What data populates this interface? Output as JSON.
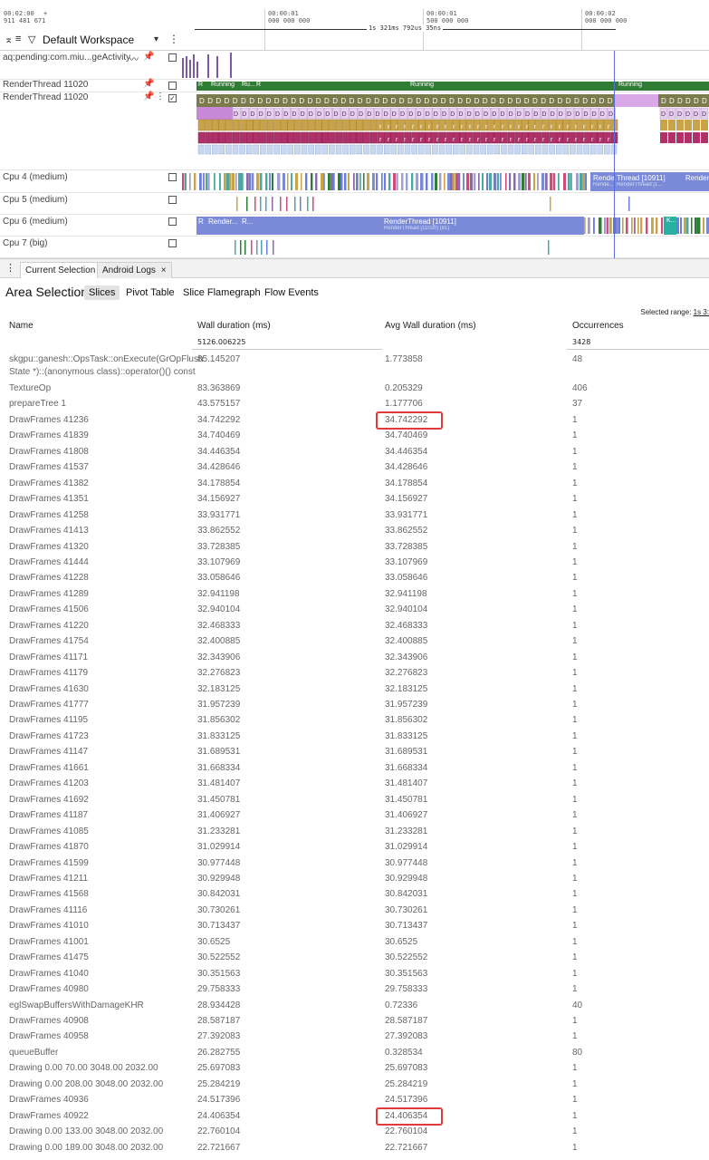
{
  "ruler": {
    "origin_time": "00:02:00",
    "origin_ns": "911 481 671",
    "plus": "+",
    "ticks": [
      {
        "t1": "00:00:01",
        "t2": "000 000 000"
      },
      {
        "t1": "00:00:01",
        "t2": "500 000 000"
      },
      {
        "t1": "00:00:02",
        "t2": "000 000 000"
      }
    ],
    "span_label": "1s 321ms 792us 35ns"
  },
  "workspace": {
    "name": "Default Workspace",
    "icons": [
      "collapse-icon",
      "list-icon",
      "filter-icon",
      "chevron-down-icon",
      "more-icon"
    ]
  },
  "tracks": [
    {
      "name": "aq:pending:com.miu...geActivity"
    },
    {
      "name": "RenderThread 11020",
      "state_labels": [
        "R",
        "Running",
        "Ru...",
        "R",
        "Running",
        "Running"
      ]
    },
    {
      "name": "RenderThread 11020",
      "slice_letters": [
        "D",
        "r"
      ]
    },
    {
      "name": "Cpu 4 (medium)",
      "labels": [
        "Rende",
        "Thread [10911]",
        "Render",
        "Rende...",
        "RenderThread [1..."
      ]
    },
    {
      "name": "Cpu 5 (medium)"
    },
    {
      "name": "Cpu 6 (medium)",
      "labels": [
        "R",
        "Render...",
        "R...",
        "RenderThread [10911]",
        "RenderThread [11020] (81)",
        "K..."
      ]
    },
    {
      "name": "Cpu 7 (big)"
    }
  ],
  "panel": {
    "tabs": [
      "Current Selection",
      "Android Logs"
    ],
    "close_glyph": "×",
    "title": "Area Selection",
    "subtabs": [
      "Slices",
      "Pivot Table",
      "Slice Flamegraph",
      "Flow Events"
    ],
    "selected_range_label": "Selected range:",
    "selected_range_value": "1s 3:"
  },
  "table": {
    "headers": {
      "name": "Name",
      "wall": "Wall duration (ms)",
      "avg": "Avg Wall duration (ms)",
      "occ": "Occurrences"
    },
    "totals": {
      "wall": "5126.006225",
      "occ": "3428"
    },
    "first_row": {
      "name_line1": "skgpu::ganesh::OpsTask::onExecute(GrOpFlush",
      "name_line2": "State *)::(anonymous class)::operator()() const",
      "wall": "85.145207",
      "avg": "1.773858",
      "occ": "48"
    },
    "rows": [
      [
        "TextureOp",
        "83.363869",
        "0.205329",
        "406"
      ],
      [
        "prepareTree 1",
        "43.575157",
        "1.177706",
        "37"
      ],
      [
        "DrawFrames 41236",
        "34.742292",
        "34.742292",
        "1"
      ],
      [
        "DrawFrames 41839",
        "34.740469",
        "34.740469",
        "1"
      ],
      [
        "DrawFrames 41808",
        "34.446354",
        "34.446354",
        "1"
      ],
      [
        "DrawFrames 41537",
        "34.428646",
        "34.428646",
        "1"
      ],
      [
        "DrawFrames 41382",
        "34.178854",
        "34.178854",
        "1"
      ],
      [
        "DrawFrames 41351",
        "34.156927",
        "34.156927",
        "1"
      ],
      [
        "DrawFrames 41258",
        "33.931771",
        "33.931771",
        "1"
      ],
      [
        "DrawFrames 41413",
        "33.862552",
        "33.862552",
        "1"
      ],
      [
        "DrawFrames 41320",
        "33.728385",
        "33.728385",
        "1"
      ],
      [
        "DrawFrames 41444",
        "33.107969",
        "33.107969",
        "1"
      ],
      [
        "DrawFrames 41228",
        "33.058646",
        "33.058646",
        "1"
      ],
      [
        "DrawFrames 41289",
        "32.941198",
        "32.941198",
        "1"
      ],
      [
        "DrawFrames 41506",
        "32.940104",
        "32.940104",
        "1"
      ],
      [
        "DrawFrames 41220",
        "32.468333",
        "32.468333",
        "1"
      ],
      [
        "DrawFrames 41754",
        "32.400885",
        "32.400885",
        "1"
      ],
      [
        "DrawFrames 41171",
        "32.343906",
        "32.343906",
        "1"
      ],
      [
        "DrawFrames 41179",
        "32.276823",
        "32.276823",
        "1"
      ],
      [
        "DrawFrames 41630",
        "32.183125",
        "32.183125",
        "1"
      ],
      [
        "DrawFrames 41777",
        "31.957239",
        "31.957239",
        "1"
      ],
      [
        "DrawFrames 41195",
        "31.856302",
        "31.856302",
        "1"
      ],
      [
        "DrawFrames 41723",
        "31.833125",
        "31.833125",
        "1"
      ],
      [
        "DrawFrames 41147",
        "31.689531",
        "31.689531",
        "1"
      ],
      [
        "DrawFrames 41661",
        "31.668334",
        "31.668334",
        "1"
      ],
      [
        "DrawFrames 41203",
        "31.481407",
        "31.481407",
        "1"
      ],
      [
        "DrawFrames 41692",
        "31.450781",
        "31.450781",
        "1"
      ],
      [
        "DrawFrames 41187",
        "31.406927",
        "31.406927",
        "1"
      ],
      [
        "DrawFrames 41085",
        "31.233281",
        "31.233281",
        "1"
      ],
      [
        "DrawFrames 41870",
        "31.029914",
        "31.029914",
        "1"
      ],
      [
        "DrawFrames 41599",
        "30.977448",
        "30.977448",
        "1"
      ],
      [
        "DrawFrames 41211",
        "30.929948",
        "30.929948",
        "1"
      ],
      [
        "DrawFrames 41568",
        "30.842031",
        "30.842031",
        "1"
      ],
      [
        "DrawFrames 41116",
        "30.730261",
        "30.730261",
        "1"
      ],
      [
        "DrawFrames 41010",
        "30.713437",
        "30.713437",
        "1"
      ],
      [
        "DrawFrames 41001",
        "30.6525",
        "30.6525",
        "1"
      ],
      [
        "DrawFrames 41475",
        "30.522552",
        "30.522552",
        "1"
      ],
      [
        "DrawFrames 41040",
        "30.351563",
        "30.351563",
        "1"
      ],
      [
        "DrawFrames 40980",
        "29.758333",
        "29.758333",
        "1"
      ],
      [
        "eglSwapBuffersWithDamageKHR",
        "28.934428",
        "0.72336",
        "40"
      ],
      [
        "DrawFrames 40908",
        "28.587187",
        "28.587187",
        "1"
      ],
      [
        "DrawFrames 40958",
        "27.392083",
        "27.392083",
        "1"
      ],
      [
        "queueBuffer",
        "26.282755",
        "0.328534",
        "80"
      ],
      [
        "Drawing 0.00 70.00 3048.00 2032.00",
        "25.697083",
        "25.697083",
        "1"
      ],
      [
        "Drawing 0.00 208.00 3048.00 2032.00",
        "25.284219",
        "25.284219",
        "1"
      ],
      [
        "DrawFrames 40936",
        "24.517396",
        "24.517396",
        "1"
      ],
      [
        "DrawFrames 40922",
        "24.406354",
        "24.406354",
        "1"
      ],
      [
        "Drawing 0.00 133.00 3048.00 2032.00",
        "22.760104",
        "22.760104",
        "1"
      ],
      [
        "Drawing 0.00 189.00 3048.00 2032.00",
        "22.721667",
        "22.721667",
        "1"
      ]
    ],
    "highlighted_rows": [
      "DrawFrames 41236",
      "DrawFrames 40922"
    ]
  },
  "colors": {
    "running_green": "#2e7d32",
    "runnable_blue": "#7a8ad8",
    "slice_olive": "#7a7a4a",
    "slice_purple": "#8e3ea8",
    "slice_gold": "#c9a34a",
    "slice_magenta": "#b0306a",
    "highlight_red": "#e03a3a",
    "cursor_blue": "#5b6ee1"
  }
}
